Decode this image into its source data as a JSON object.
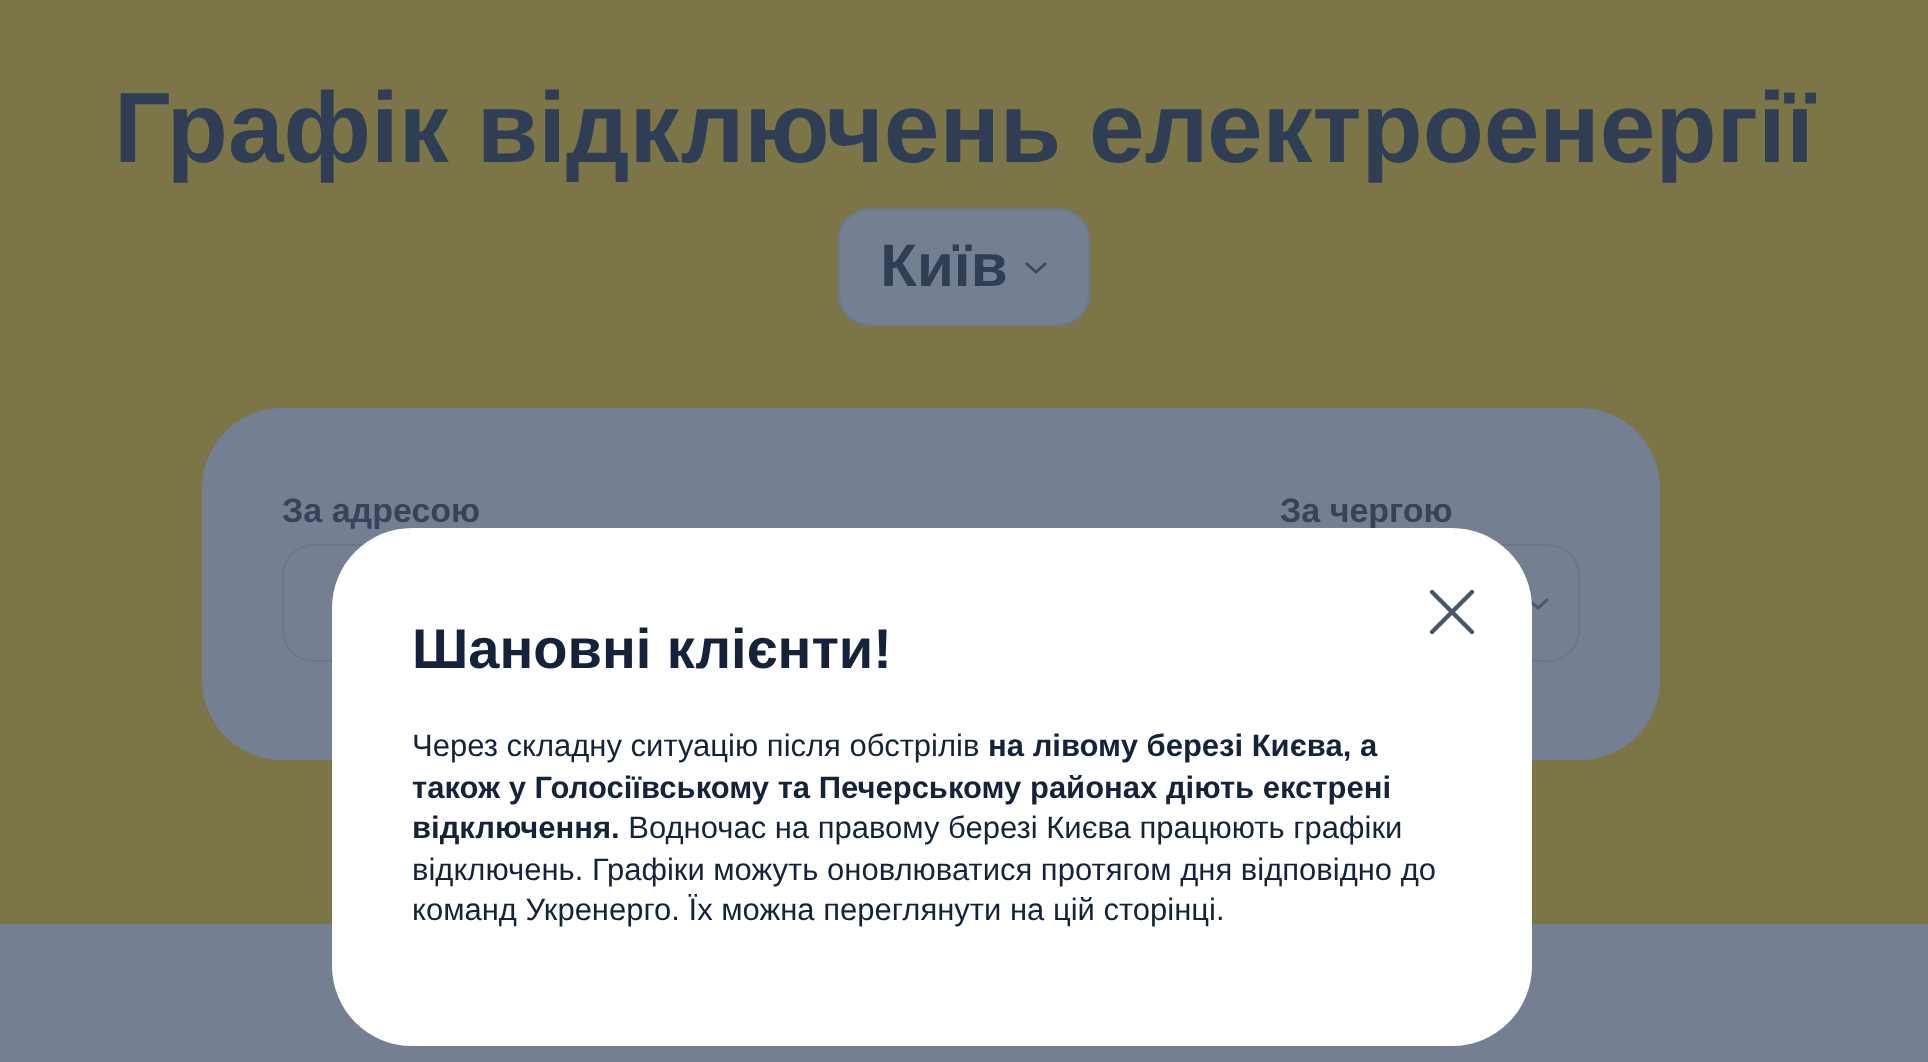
{
  "page_title": "Графік відключень електроенергії",
  "city_selector": {
    "value": "Київ"
  },
  "search_card": {
    "fields": [
      {
        "label": "За адресою",
        "kind": "wide"
      },
      {
        "label": "За чергою",
        "kind": "narrow"
      }
    ]
  },
  "modal": {
    "title": "Шановні клієнти!",
    "body": "Через складну ситуацію після обстрілів **на лівому березі Києва, а також у Голосіївському та Печерському районах діють екстрені відключення.** Водночас на правому березі Києва працюють графіки відключень. Графіки можуть оновлюватися протягом дня відповідно до команд Укренерго. Їх можна переглянути на цій сторінці."
  }
}
